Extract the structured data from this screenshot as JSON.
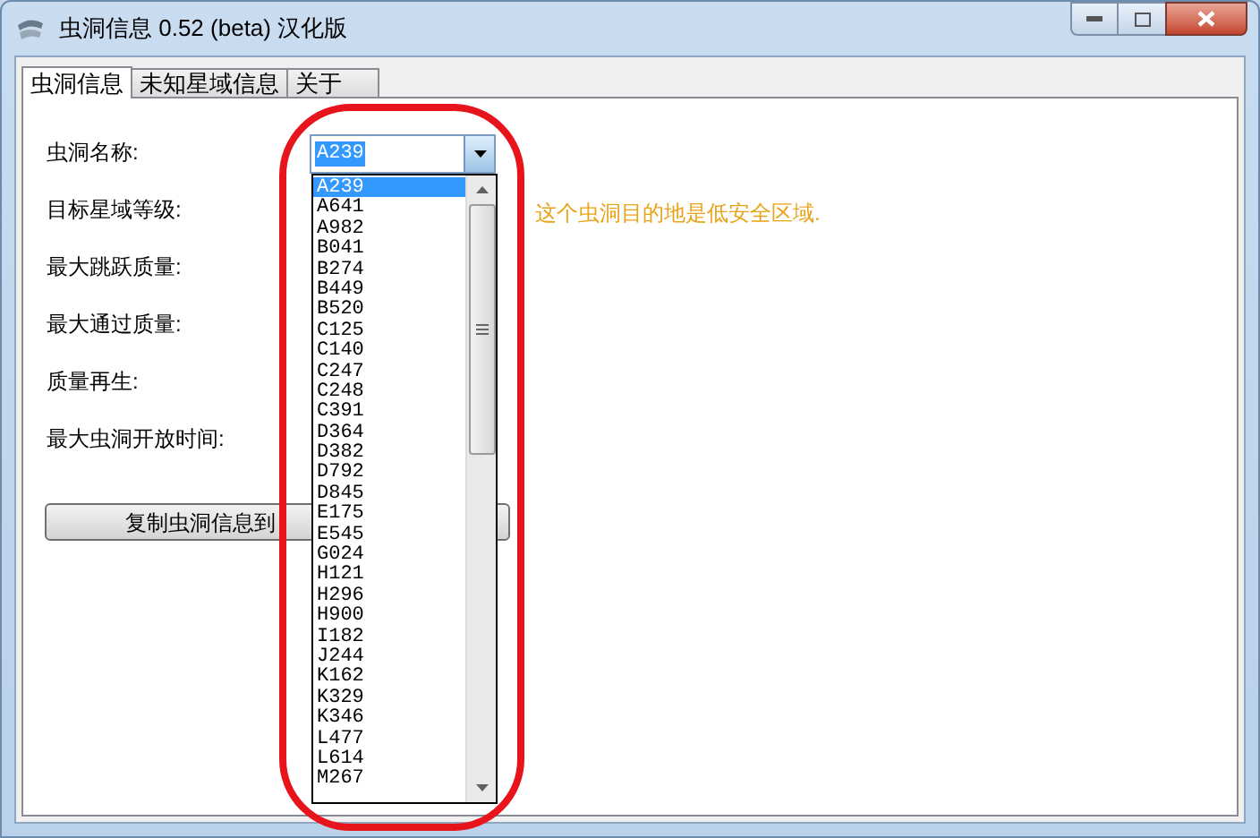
{
  "window": {
    "title": "虫洞信息 0.52 (beta) 汉化版"
  },
  "tabs": [
    {
      "label": "虫洞信息",
      "selected": true
    },
    {
      "label": "未知星域信息",
      "selected": false
    },
    {
      "label": "关于",
      "selected": false
    }
  ],
  "fields": [
    {
      "label": "虫洞名称:"
    },
    {
      "label": "目标星域等级:"
    },
    {
      "label": "最大跳跃质量:"
    },
    {
      "label": "最大通过质量:"
    },
    {
      "label": "质量再生:"
    },
    {
      "label": "最大虫洞开放时间:"
    }
  ],
  "combo": {
    "value": "A239",
    "expanded": true
  },
  "note": "这个虫洞目的地是低安全区域.",
  "copy_button": "复制虫洞信息到",
  "dropdown_items": [
    {
      "label": "A239",
      "selected": true
    },
    {
      "label": "A641",
      "selected": false
    },
    {
      "label": "A982",
      "selected": false
    },
    {
      "label": "B041",
      "selected": false
    },
    {
      "label": "B274",
      "selected": false
    },
    {
      "label": "B449",
      "selected": false
    },
    {
      "label": "B520",
      "selected": false
    },
    {
      "label": "C125",
      "selected": false
    },
    {
      "label": "C140",
      "selected": false
    },
    {
      "label": "C247",
      "selected": false
    },
    {
      "label": "C248",
      "selected": false
    },
    {
      "label": "C391",
      "selected": false
    },
    {
      "label": "D364",
      "selected": false
    },
    {
      "label": "D382",
      "selected": false
    },
    {
      "label": "D792",
      "selected": false
    },
    {
      "label": "D845",
      "selected": false
    },
    {
      "label": "E175",
      "selected": false
    },
    {
      "label": "E545",
      "selected": false
    },
    {
      "label": "G024",
      "selected": false
    },
    {
      "label": "H121",
      "selected": false
    },
    {
      "label": "H296",
      "selected": false
    },
    {
      "label": "H900",
      "selected": false
    },
    {
      "label": "I182",
      "selected": false
    },
    {
      "label": "J244",
      "selected": false
    },
    {
      "label": "K162",
      "selected": false
    },
    {
      "label": "K329",
      "selected": false
    },
    {
      "label": "K346",
      "selected": false
    },
    {
      "label": "L477",
      "selected": false
    },
    {
      "label": "L614",
      "selected": false
    },
    {
      "label": "M267",
      "selected": false
    }
  ]
}
